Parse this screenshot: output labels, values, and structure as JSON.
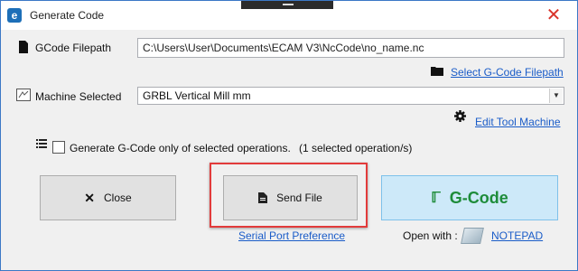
{
  "window": {
    "title": "Generate Code",
    "app_icon": "ecam-e-icon",
    "close_glyph": "✕"
  },
  "gcode_filepath": {
    "label": "GCode Filepath",
    "value": "C:\\Users\\User\\Documents\\ECAM V3\\NcCode\\no_name.nc",
    "browse_link": "Select G-Code Filepath",
    "icon": "file-icon",
    "link_icon": "folder-icon"
  },
  "machine": {
    "label": "Machine Selected",
    "selected": "GRBL Vertical Mill mm",
    "edit_link": "Edit Tool Machine",
    "icon": "machine-icon",
    "link_icon": "gear-icon"
  },
  "options": {
    "checkbox_label": "Generate G-Code only of selected operations.",
    "checked": false,
    "selected_count_text": "(1 selected operation/s)",
    "icon": "list-icon"
  },
  "buttons": {
    "close": {
      "label": "Close",
      "icon": "close-x-icon"
    },
    "send_file": {
      "label": "Send File",
      "icon": "file-send-icon"
    },
    "gcode": {
      "label": "G-Code",
      "icon": "gcode-icon",
      "accent": "#1e8c3a"
    }
  },
  "footer": {
    "serial_link": "Serial Port Preference",
    "open_with_label": "Open with :",
    "editor_link": "NOTEPAD",
    "editor_icon": "notepad-icon"
  },
  "colors": {
    "link": "#1a5cc8",
    "highlight": "#e23b3b",
    "gcode_bg": "#cde9f9",
    "gcode_text": "#1e8c3a"
  }
}
